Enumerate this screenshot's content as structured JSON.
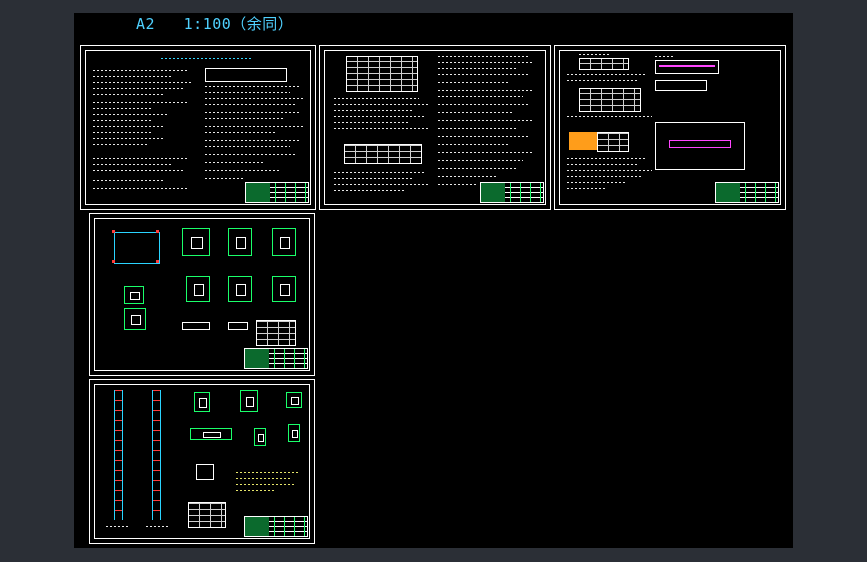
{
  "drawing": {
    "title": "A2   1:100（余同）",
    "background_color": "#000000",
    "canvas_color": "#2b2f36",
    "accent_color": "#4fd1ff"
  },
  "sheets": [
    {
      "id": "sheet-1",
      "content": "general-notes"
    },
    {
      "id": "sheet-2",
      "content": "tables-and-notes"
    },
    {
      "id": "sheet-3",
      "content": "notes-and-details"
    },
    {
      "id": "sheet-4",
      "content": "column-details"
    },
    {
      "id": "sheet-5",
      "content": "elevation-details"
    }
  ]
}
